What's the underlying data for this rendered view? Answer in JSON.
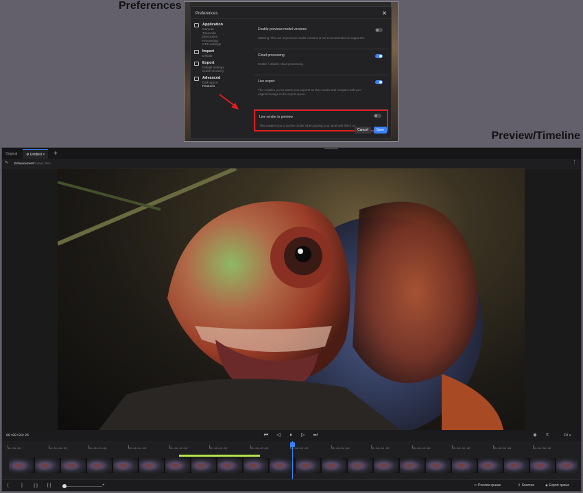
{
  "labels": {
    "preferences": "Preferences",
    "preview_timeline": "Preview/Timeline"
  },
  "preferences_dialog": {
    "title": "Preferences",
    "close_icon": "close-icon",
    "nav": [
      {
        "heading": "Application",
        "icon": "monitor-icon",
        "items": [
          "General",
          "Timecode",
          "Directories",
          "Processing",
          "GPU settings"
        ]
      },
      {
        "heading": "Import",
        "icon": "import-icon",
        "items": [
          "Default"
        ]
      },
      {
        "heading": "Export",
        "icon": "export-icon",
        "items": [
          "Default settings",
          "Crash recovery"
        ]
      },
      {
        "heading": "Advanced",
        "icon": "advanced-icon",
        "items": [
          "Disk space",
          "Features"
        ],
        "active_item": "Features"
      }
    ],
    "settings": [
      {
        "title": "Enable previous model versions",
        "description": "Warning: The use of previous model versions is not recommended or supported.",
        "enabled": false
      },
      {
        "title": "Cloud processing",
        "description": "Enable / disable cloud processing.",
        "enabled": true
      },
      {
        "title": "Live export",
        "description": "This enables you to watch your exports as they render and compare with your original footage in the export queue.",
        "enabled": true
      },
      {
        "title": "Live render in preview",
        "description": "This enables you to do live render when playing your input with filters on.",
        "enabled": false,
        "highlighted": true
      }
    ],
    "buttons": {
      "cancel": "Cancel",
      "save": "Save"
    },
    "highlight_color": "#e11d1d"
  },
  "app": {
    "tabs": [
      {
        "label": "Original"
      },
      {
        "label": "Untitled",
        "active": true
      }
    ],
    "toolbar": {
      "enhancement_label": "Enhancement",
      "enhancement_value": "Proteus, Rel..."
    },
    "transport": {
      "timecode": "00:00:03:26",
      "fit_label": "Fit ∨"
    },
    "ruler_labels": [
      "00:00:00",
      "00:00:00:25",
      "00:00:01:00",
      "00:00:01:25",
      "00:00:02:00",
      "00:00:02:25",
      "00:00:03:00",
      "00:00:03:25",
      "00:00:04:00",
      "00:00:04:25",
      "00:00:05:00",
      "00:00:05:25",
      "00:00:06:00",
      "00:00:06:25"
    ],
    "bottom": {
      "preview_queue": "Preview queue",
      "sources": "Sources",
      "export_queue": "Export queue"
    },
    "accent_color": "#3b82f6",
    "range_color": "#b4e34a"
  }
}
